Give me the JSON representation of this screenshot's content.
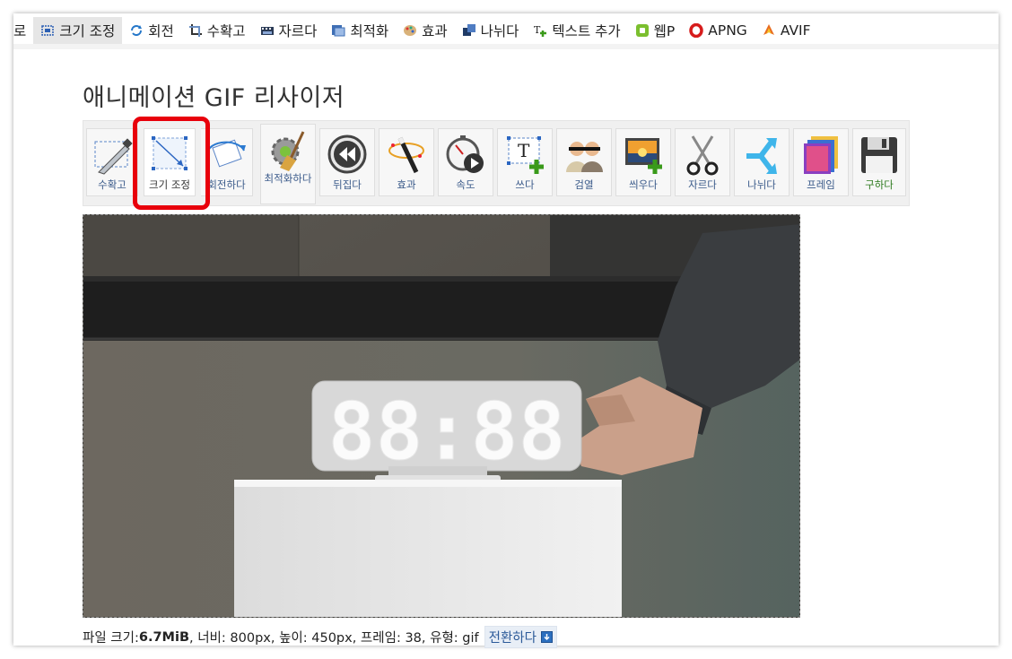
{
  "nav": {
    "items": [
      {
        "label": "로",
        "icon": "none",
        "active": false
      },
      {
        "label": "크기 조정",
        "icon": "resize-icon",
        "active": true
      },
      {
        "label": "회전",
        "icon": "rotate-icon",
        "active": false
      },
      {
        "label": "수확고",
        "icon": "crop-icon",
        "active": false
      },
      {
        "label": "자르다",
        "icon": "film-cut-icon",
        "active": false
      },
      {
        "label": "최적화",
        "icon": "optimize-icon",
        "active": false
      },
      {
        "label": "효과",
        "icon": "effects-palette-icon",
        "active": false
      },
      {
        "label": "나뉘다",
        "icon": "split-icon",
        "active": false
      },
      {
        "label": "텍스트 추가",
        "icon": "add-text-icon",
        "active": false
      },
      {
        "label": "웹P",
        "icon": "webp-icon",
        "active": false
      },
      {
        "label": "APNG",
        "icon": "apng-icon",
        "active": false
      },
      {
        "label": "AVIF",
        "icon": "avif-icon",
        "active": false
      }
    ]
  },
  "page": {
    "title": "애니메이션 GIF 리사이저"
  },
  "toolbar": {
    "tools": [
      {
        "label": "수확고",
        "icon": "crop-knife-icon"
      },
      {
        "label": "크기 조정",
        "icon": "resize-icon",
        "highlighted": true
      },
      {
        "label": "회전하다",
        "icon": "rotate-icon"
      },
      {
        "label": "최적화하다",
        "icon": "optimize-gear-broom-icon"
      },
      {
        "label": "뒤집다",
        "icon": "reverse-icon"
      },
      {
        "label": "효과",
        "icon": "magic-wand-icon"
      },
      {
        "label": "속도",
        "icon": "speed-stopwatch-icon"
      },
      {
        "label": "쓰다",
        "icon": "write-text-icon"
      },
      {
        "label": "검열",
        "icon": "censor-people-icon"
      },
      {
        "label": "씌우다",
        "icon": "overlay-image-icon"
      },
      {
        "label": "자르다",
        "icon": "scissors-icon"
      },
      {
        "label": "나뉘다",
        "icon": "split-arrow-icon"
      },
      {
        "label": "프레임",
        "icon": "frames-icon"
      },
      {
        "label": "구하다",
        "icon": "save-floppy-icon"
      }
    ]
  },
  "preview": {
    "clock_display": "88:88"
  },
  "fileinfo": {
    "size_label": "파일 크기: ",
    "size_value": "6.7MiB",
    "details": " , 너비: 800px, 높이: 450px, 프레임: 38, 유형: gif",
    "convert_label": "전환하다"
  },
  "colors": {
    "highlight": "#e8000b",
    "link": "#3a5a8a",
    "save": "#2d7a1e"
  }
}
